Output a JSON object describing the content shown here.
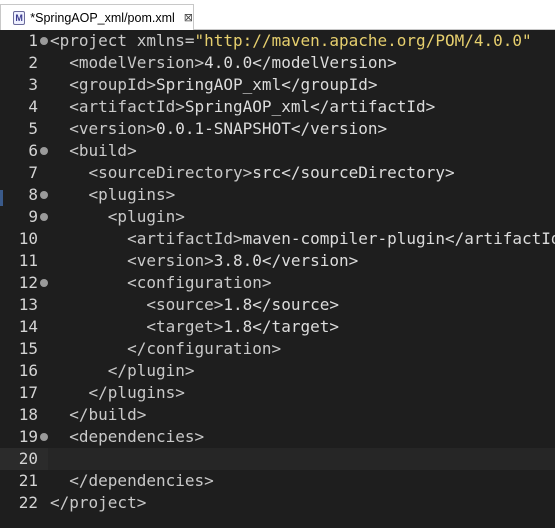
{
  "tab": {
    "icon_letter": "M",
    "title": "*SpringAOP_xml/pom.xml",
    "close_glyph": "⊠"
  },
  "lines": [
    {
      "n": "1",
      "fold": true,
      "indent": 0,
      "tag": "<project xmlns=",
      "str": "\"http://maven.apache.org/POM/4.0.0\"",
      "tail": ""
    },
    {
      "n": "2",
      "fold": false,
      "indent": 1,
      "tag": "<modelVersion>",
      "str": "",
      "tail": "4.0.0</modelVersion>"
    },
    {
      "n": "3",
      "fold": false,
      "indent": 1,
      "tag": "<groupId>",
      "str": "",
      "tail": "SpringAOP_xml</groupId>"
    },
    {
      "n": "4",
      "fold": false,
      "indent": 1,
      "tag": "<artifactId>",
      "str": "",
      "tail": "SpringAOP_xml</artifactId>"
    },
    {
      "n": "5",
      "fold": false,
      "indent": 1,
      "tag": "<version>",
      "str": "",
      "tail": "0.0.1-SNAPSHOT</version>"
    },
    {
      "n": "6",
      "fold": true,
      "indent": 1,
      "tag": "<build>",
      "str": "",
      "tail": ""
    },
    {
      "n": "7",
      "fold": false,
      "indent": 2,
      "tag": "<sourceDirectory>",
      "str": "",
      "tail": "src</sourceDirectory>"
    },
    {
      "n": "8",
      "fold": true,
      "indent": 2,
      "tag": "<plugins>",
      "str": "",
      "tail": ""
    },
    {
      "n": "9",
      "fold": true,
      "indent": 3,
      "tag": "<plugin>",
      "str": "",
      "tail": ""
    },
    {
      "n": "10",
      "fold": false,
      "indent": 4,
      "tag": "<artifactId>",
      "str": "",
      "tail": "maven-compiler-plugin</artifactId>"
    },
    {
      "n": "11",
      "fold": false,
      "indent": 4,
      "tag": "<version>",
      "str": "",
      "tail": "3.8.0</version>"
    },
    {
      "n": "12",
      "fold": true,
      "indent": 4,
      "tag": "<configuration>",
      "str": "",
      "tail": ""
    },
    {
      "n": "13",
      "fold": false,
      "indent": 5,
      "tag": "<source>",
      "str": "",
      "tail": "1.8</source>"
    },
    {
      "n": "14",
      "fold": false,
      "indent": 5,
      "tag": "<target>",
      "str": "",
      "tail": "1.8</target>"
    },
    {
      "n": "15",
      "fold": false,
      "indent": 4,
      "tag": "</configuration>",
      "str": "",
      "tail": ""
    },
    {
      "n": "16",
      "fold": false,
      "indent": 3,
      "tag": "</plugin>",
      "str": "",
      "tail": ""
    },
    {
      "n": "17",
      "fold": false,
      "indent": 2,
      "tag": "</plugins>",
      "str": "",
      "tail": ""
    },
    {
      "n": "18",
      "fold": false,
      "indent": 1,
      "tag": "</build>",
      "str": "",
      "tail": ""
    },
    {
      "n": "19",
      "fold": true,
      "indent": 1,
      "tag": "<dependencies>",
      "str": "",
      "tail": ""
    },
    {
      "n": "20",
      "fold": false,
      "indent": 0,
      "tag": "",
      "str": "",
      "tail": "",
      "current": true
    },
    {
      "n": "21",
      "fold": false,
      "indent": 1,
      "tag": "</dependencies>",
      "str": "",
      "tail": ""
    },
    {
      "n": "22",
      "fold": false,
      "indent": 0,
      "tag": "</project>",
      "str": "",
      "tail": ""
    }
  ]
}
